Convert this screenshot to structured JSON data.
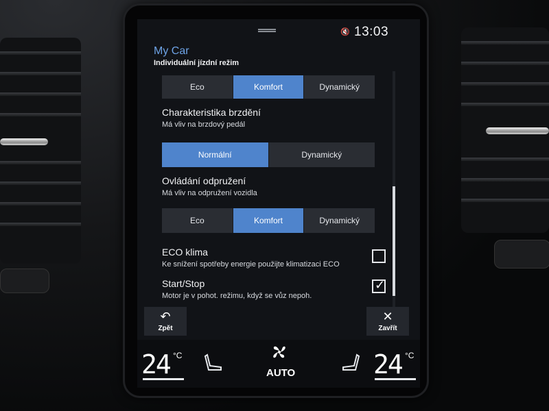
{
  "status": {
    "time": "13:03",
    "mute_icon": "mute-icon"
  },
  "header": {
    "app_title": "My Car",
    "subtitle": "Individuální jízdní režim"
  },
  "drive_mode": {
    "options": [
      "Eco",
      "Komfort",
      "Dynamický"
    ],
    "selected": "Komfort"
  },
  "brake": {
    "title": "Charakteristika brzdění",
    "description": "Má vliv na brzdový pedál",
    "options": [
      "Normální",
      "Dynamický"
    ],
    "selected": "Normální"
  },
  "suspension": {
    "title": "Ovládání odpružení",
    "description": "Má vliv na odpružení vozidla",
    "options": [
      "Eco",
      "Komfort",
      "Dynamický"
    ],
    "selected": "Komfort"
  },
  "eco_climate": {
    "title": "ECO klima",
    "description": "Ke snížení spotřeby energie použijte klimatizaci ECO",
    "checked": false
  },
  "start_stop": {
    "title": "Start/Stop",
    "description": "Motor je v pohot. režimu, když se vůz nepoh.",
    "checked": true
  },
  "actions": {
    "back_label": "Zpět",
    "close_label": "Zavřít"
  },
  "climate": {
    "left_temp": "24",
    "right_temp": "24",
    "unit": "°C",
    "mode_label": "AUTO"
  },
  "colors": {
    "accent": "#4f84cc",
    "title": "#6ea3e6"
  }
}
